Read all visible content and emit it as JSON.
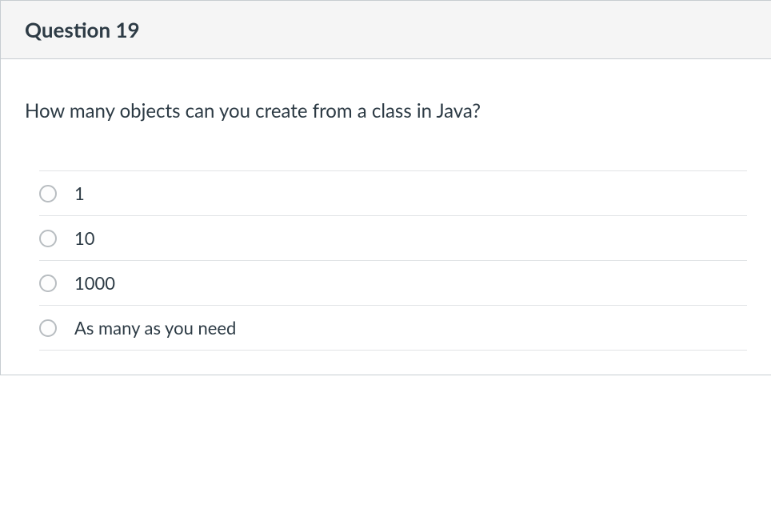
{
  "header": {
    "title": "Question 19"
  },
  "question": {
    "prompt": "How many objects can you create from a class in Java?"
  },
  "options": [
    {
      "label": "1"
    },
    {
      "label": "10"
    },
    {
      "label": "1000"
    },
    {
      "label": "As many as you need"
    }
  ]
}
